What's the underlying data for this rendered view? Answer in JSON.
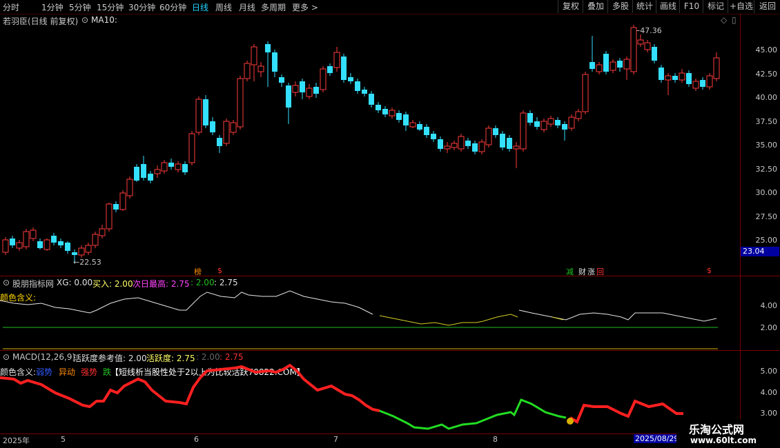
{
  "toolbar": {
    "periods": [
      "分时",
      "1分钟",
      "5分钟",
      "15分钟",
      "30分钟",
      "60分钟",
      "日线",
      "周线",
      "月线",
      "多周期",
      "更多 >"
    ],
    "active_period": "日线",
    "right_buttons": [
      "复权",
      "叠加",
      "多股",
      "统计",
      "画线",
      "F10",
      "+自选",
      "返回"
    ],
    "right_extra": "标记"
  },
  "main_panel": {
    "stock_title": "若羽臣(日线 前复权)",
    "ma_label": "MA10:",
    "high_marker": "47.36",
    "low_marker": "22.53",
    "price_tag": "23.04",
    "y_ticks": [
      "45.00",
      "42.50",
      "40.00",
      "37.50",
      "35.00",
      "32.50",
      "30.00",
      "27.50",
      "25.00"
    ],
    "icons": [
      {
        "text": "榜",
        "color": "#ff8c00"
      },
      {
        "text": "$",
        "color": "#ff3030"
      },
      {
        "text": "减",
        "color": "#22c022"
      },
      {
        "text": "财",
        "color": "#e0e0e0"
      },
      {
        "text": "涨",
        "color": "#e0e0e0"
      },
      {
        "text": "回",
        "color": "#ff3030"
      },
      {
        "text": "$",
        "color": "#ff3030"
      }
    ]
  },
  "panel2": {
    "title": "股朋指标网",
    "xg": "XG: 0.00",
    "buy": "买入: 2.00",
    "next_high": "次日最高: 2.75",
    "v2": ": 2.00",
    "v3": ": 2.75",
    "legend_text": "颜色含义:",
    "y_ticks": [
      "4.00",
      "2.00"
    ]
  },
  "panel3": {
    "title": "MACD(12,26,9)",
    "ref": "活跃度参考值: 2.00",
    "active": "活跃度: 2.75",
    "v2": ": 2.00",
    "v3": ": 2.75",
    "legend_prefix": "颜色含义:",
    "legend_items": [
      {
        "text": "弱势",
        "color": "#2f5bff"
      },
      {
        "text": "异动",
        "color": "#ff8c00"
      },
      {
        "text": "强势",
        "color": "#ff3030"
      },
      {
        "text": "跌",
        "color": "#22c022"
      }
    ],
    "note": "【短线析当股性处于2以上为比较活跃70822.COM】",
    "y_ticks": [
      "5.00",
      "4.00",
      "3.00"
    ]
  },
  "date_axis": {
    "labels": [
      "2025年",
      "5",
      "6",
      "7",
      "8"
    ],
    "current": "2025/08/29"
  },
  "watermark": {
    "title": "乐淘公式网",
    "url": "www.60lt.com"
  }
}
